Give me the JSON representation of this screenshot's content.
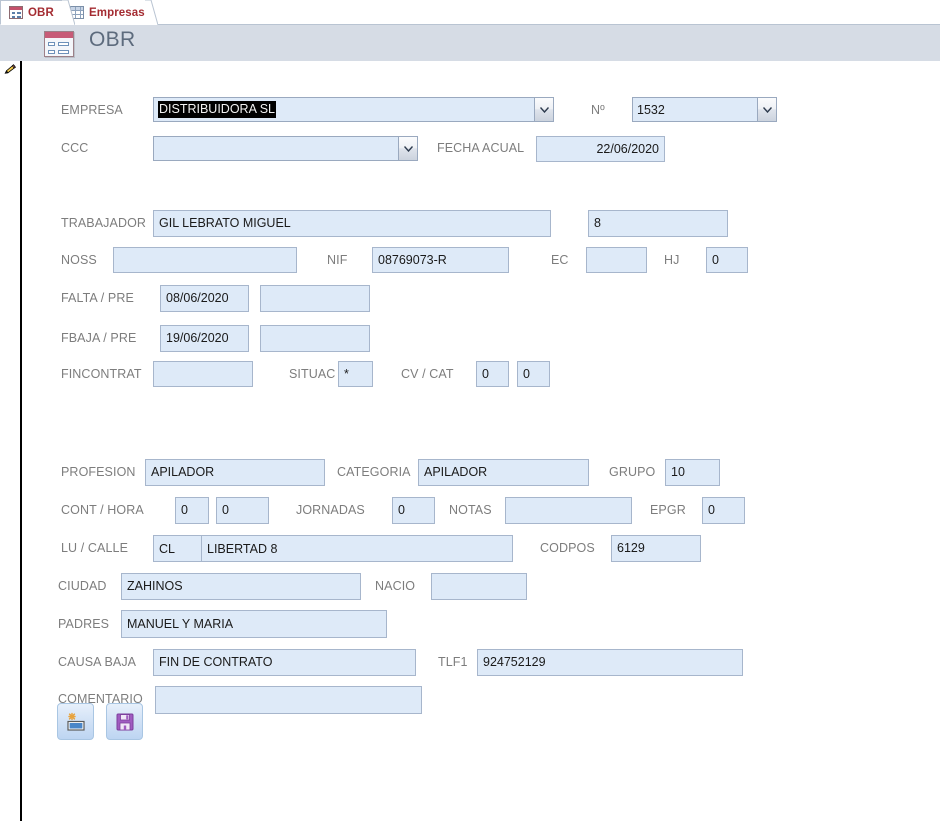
{
  "window": {
    "tabs": [
      {
        "label": "OBR",
        "icon": "form-icon",
        "active": true
      },
      {
        "label": "Empresas",
        "icon": "datasheet-icon",
        "active": false
      }
    ]
  },
  "header": {
    "title": "OBR",
    "icon": "form-icon"
  },
  "record_selector": {
    "icon": "pencil-edit-icon"
  },
  "colors": {
    "header_band": "#d6dce5",
    "field_fill": "#deeaf8",
    "field_border": "#a7b6cc",
    "label_text": "#7d7d7d",
    "tab_text": "#a42c32",
    "title_text": "#5d6b7d",
    "selection_highlight": "#000000"
  },
  "form": {
    "empresa": {
      "label": "EMPRESA",
      "value": "DISTRIBUIDORA SL",
      "selected": true,
      "control": "combobox"
    },
    "numero": {
      "label": "Nº",
      "value": "1532",
      "control": "combobox"
    },
    "ccc": {
      "label": "CCC",
      "value": "",
      "control": "combobox"
    },
    "fecha_acual": {
      "label": "FECHA ACUAL",
      "value": "22/06/2020"
    },
    "trabajador": {
      "label": "TRABAJADOR",
      "value": "GIL LEBRATO MIGUEL"
    },
    "trabajador_num": {
      "value": "8"
    },
    "noss": {
      "label": "NOSS",
      "value": ""
    },
    "nif": {
      "label": "NIF",
      "value": "08769073-R"
    },
    "ec": {
      "label": "EC",
      "value": ""
    },
    "hj": {
      "label": "HJ",
      "value": "0"
    },
    "falta_pre": {
      "label": "FALTA  /  PRE",
      "value": "08/06/2020",
      "value2": ""
    },
    "fbaja_pre": {
      "label": "FBAJA  /  PRE",
      "value": "19/06/2020",
      "value2": ""
    },
    "fincontrat": {
      "label": "FINCONTRAT",
      "value": ""
    },
    "situac": {
      "label": "SITUAC",
      "value": "*"
    },
    "cv_cat": {
      "label": "CV  / CAT",
      "value": "0",
      "value2": "0"
    },
    "profesion": {
      "label": "PROFESION",
      "value": "APILADOR"
    },
    "categoria": {
      "label": "CATEGORIA",
      "value": "APILADOR"
    },
    "grupo": {
      "label": "GRUPO",
      "value": "10"
    },
    "cont_hora": {
      "label": "CONT  /  HORA",
      "value": "0",
      "value2": "0"
    },
    "jornadas": {
      "label": "JORNADAS",
      "value": "0"
    },
    "notas": {
      "label": "NOTAS",
      "value": ""
    },
    "epgr": {
      "label": "EPGR",
      "value": "0"
    },
    "lu_calle": {
      "label": "LU  /  CALLE",
      "value": "CL",
      "value2": "LIBERTAD 8"
    },
    "codpos": {
      "label": "CODPOS",
      "value": "6129"
    },
    "ciudad": {
      "label": "CIUDAD",
      "value": "ZAHINOS"
    },
    "nacio": {
      "label": "NACIO",
      "value": ""
    },
    "padres": {
      "label": "PADRES",
      "value": "MANUEL Y MARIA"
    },
    "causa_baja": {
      "label": "CAUSA BAJA",
      "value": "FIN DE CONTRATO"
    },
    "tlf1": {
      "label": "TLF1",
      "value": "924752129"
    },
    "comentario": {
      "label": "COMENTARIO",
      "value": ""
    }
  },
  "buttons": [
    {
      "name": "new-record-button",
      "icon": "new-record-icon"
    },
    {
      "name": "save-record-button",
      "icon": "save-floppy-icon"
    }
  ]
}
